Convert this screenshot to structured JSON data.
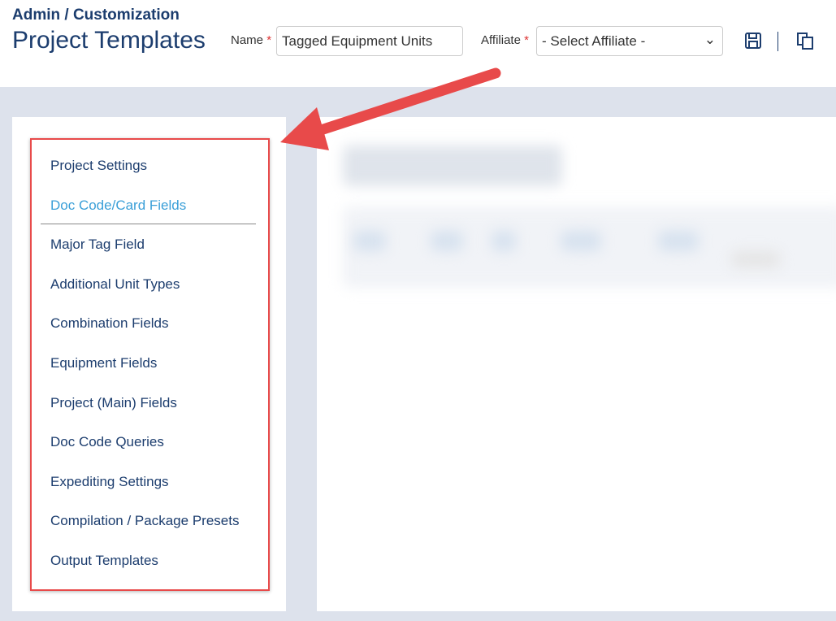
{
  "header": {
    "breadcrumb": "Admin / Customization",
    "title": "Project Templates",
    "name_label": "Name",
    "name_value": "Tagged Equipment Units",
    "affiliate_label": "Affiliate",
    "affiliate_value": "- Select Affiliate -",
    "required_mark": "*",
    "icons": [
      "save-icon",
      "copy-icon"
    ]
  },
  "sidebar": {
    "active_index": 1,
    "items": [
      {
        "label": "Project Settings"
      },
      {
        "label": "Doc Code/Card Fields"
      },
      {
        "label": "Major Tag Field"
      },
      {
        "label": "Additional Unit Types"
      },
      {
        "label": "Combination Fields"
      },
      {
        "label": "Equipment Fields"
      },
      {
        "label": "Project (Main) Fields"
      },
      {
        "label": "Doc Code Queries"
      },
      {
        "label": "Expediting Settings"
      },
      {
        "label": "Compilation / Package Presets"
      },
      {
        "label": "Output Templates"
      }
    ]
  },
  "colors": {
    "primary": "#1c3d6e",
    "active": "#3a9fd8",
    "highlight": "#e84a4a",
    "background": "#dde2ec"
  }
}
